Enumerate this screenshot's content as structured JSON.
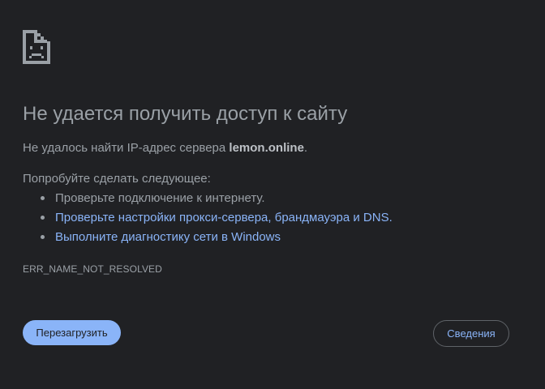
{
  "error": {
    "title": "Не удается получить доступ к сайту",
    "detail_prefix": "Не удалось найти IP-адрес сервера ",
    "host": "lemon.online",
    "detail_suffix": ".",
    "suggestions_heading": "Попробуйте сделать следующее:",
    "suggestions": [
      {
        "label": "Проверьте подключение к интернету.",
        "is_link": false
      },
      {
        "label": "Проверьте настройки прокси-сервера, брандмауэра и DNS.",
        "is_link": true
      },
      {
        "label": "Выполните диагностику сети в Windows",
        "is_link": true
      }
    ],
    "code": "ERR_NAME_NOT_RESOLVED"
  },
  "buttons": {
    "reload_label": "Перезагрузить",
    "details_label": "Сведения"
  },
  "icons": {
    "error_page": "sad-document-icon"
  },
  "colors": {
    "background": "#202124",
    "text": "#9aa0a6",
    "link": "#8ab4f8",
    "primary_button": "#8ab4f8"
  }
}
